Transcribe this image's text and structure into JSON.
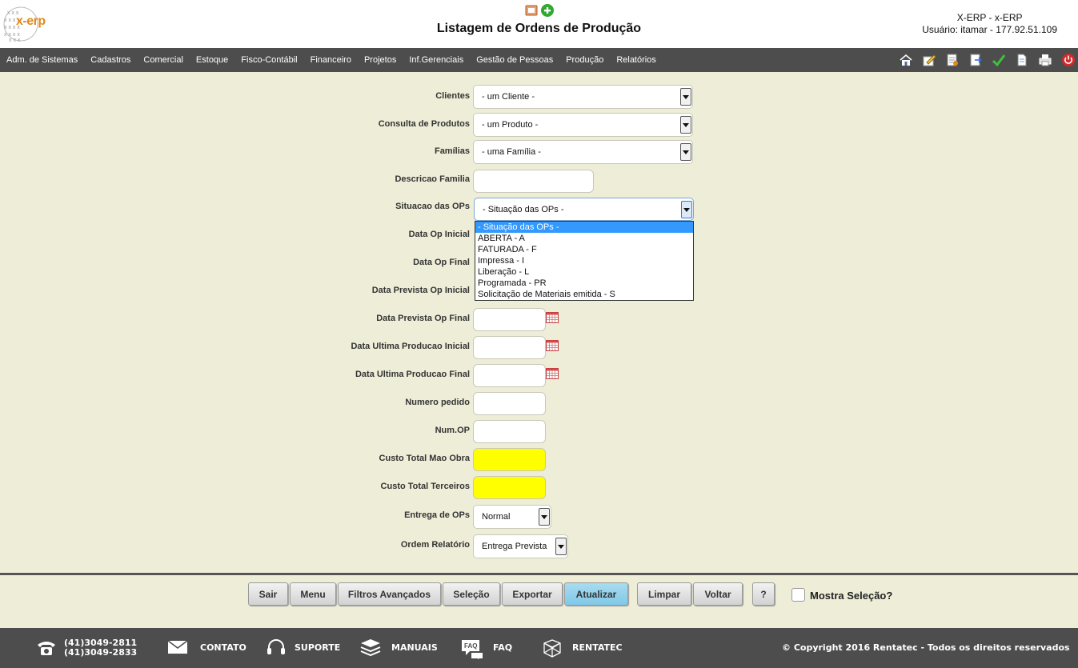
{
  "app": {
    "logo_text": "x-erp",
    "page_title": "Listagem de Ordens de Produção",
    "system": "X-ERP - x-ERP",
    "user": "Usuário: itamar - 177.92.51.109"
  },
  "menu": [
    "Adm. de Sistemas",
    "Cadastros",
    "Comercial",
    "Estoque",
    "Fisco-Contábil",
    "Financeiro",
    "Projetos",
    "Inf.Gerenciais",
    "Gestão de Pessoas",
    "Produção",
    "Relatórios"
  ],
  "toolbar_icons": [
    "home-icon",
    "edit-icon",
    "document-icon",
    "export-icon",
    "check-icon",
    "page-icon",
    "print-icon",
    "power-icon"
  ],
  "form": {
    "clientes": {
      "label": "Clientes",
      "value": "- um Cliente -"
    },
    "produtos": {
      "label": "Consulta de Produtos",
      "value": "- um Produto -"
    },
    "familias": {
      "label": "Famílias",
      "value": "- uma Família -"
    },
    "descricao_familia": {
      "label": "Descricao Familia",
      "value": ""
    },
    "situacao": {
      "label": "Situacao das OPs",
      "value": "- Situação das OPs -"
    },
    "data_op_inicial": {
      "label": "Data Op Inicial"
    },
    "data_op_final": {
      "label": "Data Op Final"
    },
    "data_prevista_inicial": {
      "label": "Data Prevista Op Inicial"
    },
    "data_prevista_final": {
      "label": "Data Prevista Op Final"
    },
    "data_ult_prod_inicial": {
      "label": "Data Ultima Producao Inicial"
    },
    "data_ult_prod_final": {
      "label": "Data Ultima Producao Final"
    },
    "numero_pedido": {
      "label": "Numero pedido"
    },
    "num_op": {
      "label": "Num.OP"
    },
    "custo_mao_obra": {
      "label": "Custo Total Mao Obra"
    },
    "custo_terceiros": {
      "label": "Custo Total Terceiros"
    },
    "entrega": {
      "label": "Entrega de OPs",
      "value": "Normal"
    },
    "ordem": {
      "label": "Ordem Relatório",
      "value": "Entrega Prevista"
    }
  },
  "situacao_options": [
    "- Situação das OPs -",
    "ABERTA - A",
    "FATURADA - F",
    "Impressa - I",
    "Liberação - L",
    "Programada - PR",
    "Solicitação de Materiais emitida - S"
  ],
  "buttons": {
    "sair": "Sair",
    "menu": "Menu",
    "filtros": "Filtros Avançados",
    "selecao": "Seleção",
    "exportar": "Exportar",
    "atualizar": "Atualizar",
    "limpar": "Limpar",
    "voltar": "Voltar",
    "help": "?"
  },
  "mostra_selecao": "Mostra Seleção?",
  "footer": {
    "phone1": "(41)3049-2811",
    "phone2": "(41)3049-2833",
    "contato": "CONTATO",
    "suporte": "SUPORTE",
    "manuais": "MANUAIS",
    "faq": "FAQ",
    "faq_icon_text": "FAQ",
    "rentatec": "RENTATEC",
    "copyright": "© Copyright 2016 Rentatec - Todos os direitos reservados"
  }
}
